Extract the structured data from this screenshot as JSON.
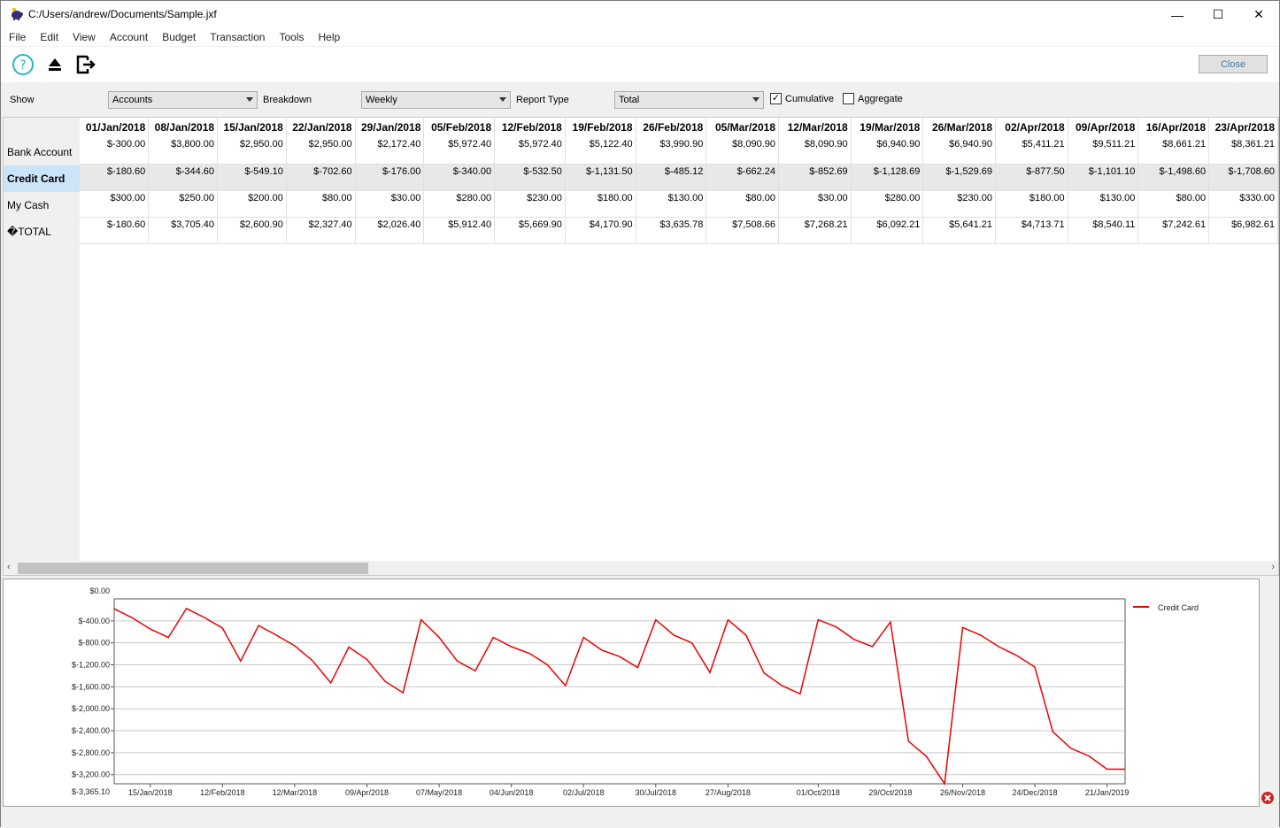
{
  "window": {
    "title": "C:/Users/andrew/Documents/Sample.jxf",
    "minimize": "—",
    "maximize": "☐",
    "close": "✕"
  },
  "menu": [
    "File",
    "Edit",
    "View",
    "Account",
    "Budget",
    "Transaction",
    "Tools",
    "Help"
  ],
  "toolbar": {
    "close_label": "Close",
    "icons": [
      "help-icon",
      "eject-icon",
      "exit-icon"
    ]
  },
  "filters": {
    "show_label": "Show",
    "show_value": "Accounts",
    "breakdown_label": "Breakdown",
    "breakdown_value": "Weekly",
    "report_type_label": "Report Type",
    "report_type_value": "Total",
    "cumulative_label": "Cumulative",
    "cumulative_checked": true,
    "aggregate_label": "Aggregate",
    "aggregate_checked": false
  },
  "grid": {
    "row_labels": [
      "Bank Account",
      "Credit Card",
      "My Cash",
      "�TOTAL"
    ],
    "selected_row": 1,
    "columns": [
      "01/Jan/2018",
      "08/Jan/2018",
      "15/Jan/2018",
      "22/Jan/2018",
      "29/Jan/2018",
      "05/Feb/2018",
      "12/Feb/2018",
      "19/Feb/2018",
      "26/Feb/2018",
      "05/Mar/2018",
      "12/Mar/2018",
      "19/Mar/2018",
      "26/Mar/2018",
      "02/Apr/2018",
      "09/Apr/2018",
      "16/Apr/2018",
      "23/Apr/2018"
    ],
    "rows": [
      [
        "$-300.00",
        "$3,800.00",
        "$2,950.00",
        "$2,950.00",
        "$2,172.40",
        "$5,972.40",
        "$5,972.40",
        "$5,122.40",
        "$3,990.90",
        "$8,090.90",
        "$8,090.90",
        "$6,940.90",
        "$6,940.90",
        "$5,411.21",
        "$9,511.21",
        "$8,661.21",
        "$8,361.21"
      ],
      [
        "$-180.60",
        "$-344.60",
        "$-549.10",
        "$-702.60",
        "$-176.00",
        "$-340.00",
        "$-532.50",
        "$-1,131.50",
        "$-485.12",
        "$-662.24",
        "$-852.69",
        "$-1,128.69",
        "$-1,529.69",
        "$-877.50",
        "$-1,101.10",
        "$-1,498.60",
        "$-1,708.60"
      ],
      [
        "$300.00",
        "$250.00",
        "$200.00",
        "$80.00",
        "$30.00",
        "$280.00",
        "$230.00",
        "$180.00",
        "$130.00",
        "$80.00",
        "$30.00",
        "$280.00",
        "$230.00",
        "$180.00",
        "$130.00",
        "$80.00",
        "$330.00"
      ],
      [
        "$-180.60",
        "$3,705.40",
        "$2,600.90",
        "$2,327.40",
        "$2,026.40",
        "$5,912.40",
        "$5,669.90",
        "$4,170.90",
        "$3,635.78",
        "$7,508.66",
        "$7,268.21",
        "$6,092.21",
        "$5,641.21",
        "$4,713.71",
        "$8,540.11",
        "$7,242.61",
        "$6,982.61"
      ]
    ]
  },
  "chart_data": {
    "type": "line",
    "legend_placement": "top-right",
    "series": [
      {
        "name": "Credit Card",
        "color": "#ee0000",
        "values": [
          -180.6,
          -344.6,
          -549.1,
          -702.6,
          -176.0,
          -340.0,
          -532.5,
          -1131.5,
          -485.12,
          -662.24,
          -852.69,
          -1128.69,
          -1529.69,
          -877.5,
          -1101.1,
          -1498.6,
          -1708.6,
          -380,
          -700,
          -1130,
          -1310,
          -700,
          -870,
          -990,
          -1200,
          -1580,
          -700,
          -930,
          -1050,
          -1250,
          -380,
          -660,
          -800,
          -1340,
          -380,
          -660,
          -1350,
          -1580,
          -1730,
          -380,
          -510,
          -740,
          -870,
          -420,
          -2590,
          -2870,
          -3365.1,
          -520,
          -660,
          -870,
          -1030,
          -1240,
          -2420,
          -2720,
          -2860,
          -3100,
          -3100
        ]
      }
    ],
    "x_tick_labels": [
      "15/Jan/2018",
      "12/Feb/2018",
      "12/Mar/2018",
      "09/Apr/2018",
      "07/May/2018",
      "04/Jun/2018",
      "02/Jul/2018",
      "30/Jul/2018",
      "27/Aug/2018",
      "01/Oct/2018",
      "29/Oct/2018",
      "26/Nov/2018",
      "24/Dec/2018",
      "21/Jan/2019"
    ],
    "x_tick_index": [
      2,
      6,
      10,
      14,
      18,
      22,
      26,
      30,
      34,
      39,
      43,
      47,
      51,
      55
    ],
    "y_ticks": [
      -400,
      -800,
      -1200,
      -1600,
      -2000,
      -2400,
      -2800,
      -3200
    ],
    "y_tick_labels": [
      "$-400.00",
      "$-800.00",
      "$-1,200.00",
      "$-1,600.00",
      "$-2,000.00",
      "$-2,400.00",
      "$-2,800.00",
      "$-3,200.00"
    ],
    "y_max_label": "$0.00",
    "y_min_label": "$-3,365.10",
    "ylim": [
      -3365.1,
      0
    ],
    "grid": true
  }
}
